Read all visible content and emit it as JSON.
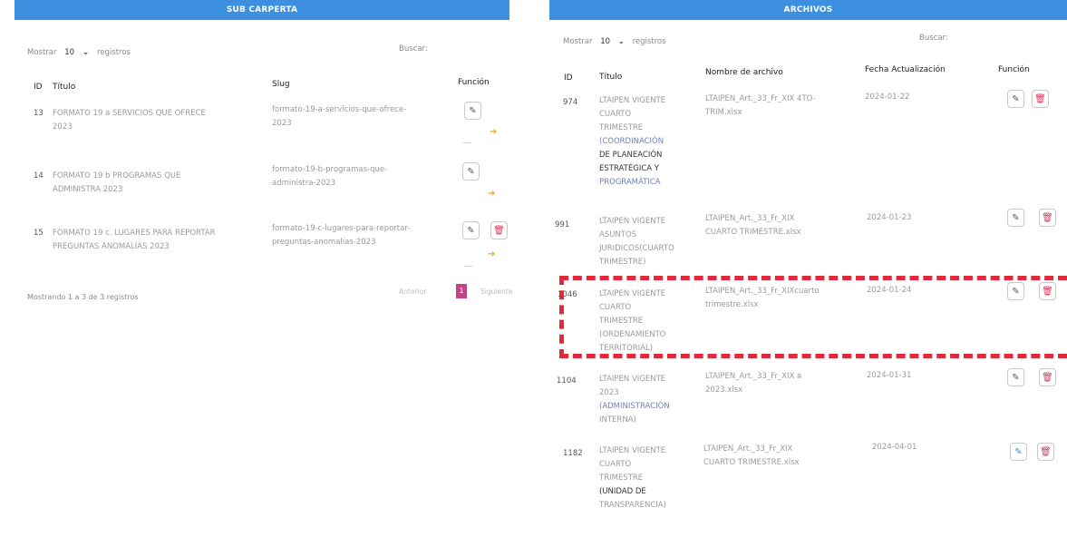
{
  "left": {
    "header": "SUB CARPERTA",
    "show": {
      "prefix": "Mostrar",
      "value": "10",
      "suffix": "registros"
    },
    "search_label": "Buscar:",
    "columns": {
      "id": "ID",
      "title": "Título",
      "slug": "Slug",
      "function": "Función"
    },
    "rows": [
      {
        "id": "13",
        "title_a": "FORMATO 19 a SERVICIOS QUE OFRECE",
        "title_b": "2023",
        "slug_a": "formato-19-a-servicios-que-ofrece-",
        "slug_b": "2023"
      },
      {
        "id": "14",
        "title_a": "FORMATO 19 b PROGRAMAS QUE",
        "title_b": "ADMINISTRA 2023",
        "slug_a": "formato-19-b-programas-que-",
        "slug_b": "administra-2023"
      },
      {
        "id": "15",
        "title_a": "FORMATO 19 c. LUGARES PARA REPORTAR",
        "title_b": "PREGUNTAS ANOMALÍAS 2023",
        "slug_a": "formato-19-c-lugares-para-reportar-",
        "slug_b": "preguntas-anomalias-2023"
      }
    ],
    "footer": "Mostrando 1 a 3 de 3 registros",
    "pager": {
      "prev": "Anterior",
      "page": "1",
      "next": "Siguiente"
    }
  },
  "right": {
    "header": "ARCHIVOS",
    "show": {
      "prefix": "Mostrar",
      "value": "10",
      "suffix": "registros"
    },
    "search_label": "Buscar:",
    "columns": {
      "id": "ID",
      "title": "Título",
      "filename": "Nombre de archivo",
      "date": "Fecha Actualización",
      "function": "Función"
    },
    "rows": [
      {
        "id": "974",
        "title": [
          "LTAIPEN VIGENTE",
          "CUARTO",
          "TRIMESTRE",
          "(COORDINACIÓN",
          "DE PLANEACIÓN",
          "ESTRATÉGICA Y",
          "PROGRAMÁTICA"
        ],
        "file": [
          "LTAIPEN_Art._33_Fr_XIX 4TO-",
          "TRIM.xlsx"
        ],
        "date": "2024-01-22"
      },
      {
        "id": "991",
        "title": [
          "LTAIPEN VIGENTE",
          "ASUNTOS",
          "JURIDICOS(CUARTO",
          "TRIMESTRE)"
        ],
        "file": [
          "LTAIPEN_Art._33_Fr_XIX",
          "CUARTO TRIMESTRE.xlsx"
        ],
        "date": "2024-01-23"
      },
      {
        "id": "1046",
        "title": [
          "LTAIPEN VIGENTE",
          "CUARTO",
          "TRIMESTRE",
          "(ORDENAMIENTO",
          "TERRITORIAL)"
        ],
        "file": [
          "LTAIPEN_Art._33_Fr_XIXcuarto",
          "trimestre.xlsx"
        ],
        "date": "2024-01-24"
      },
      {
        "id": "1104",
        "title": [
          "LTAIPEN VIGENTE",
          "2023",
          "(ADMINISTRACIÓN",
          "INTERNA)"
        ],
        "file": [
          "LTAIPEN_Art._33_Fr_XIX a",
          "2023.xlsx"
        ],
        "date": "2024-01-31"
      },
      {
        "id": "1182",
        "title": [
          "LTAIPEN VIGENTE",
          "CUARTO",
          "TRIMESTRE",
          "(UNIDAD DE",
          "TRANSPARENCIA)"
        ],
        "file": [
          "LTAIPEN_Art._33_Fr_XIX",
          "CUARTO TRIMESTRE.xlsx"
        ],
        "date": "2024-04-01"
      }
    ]
  },
  "colors": {
    "header": "#3d8fe0",
    "delete": "#d63a5a",
    "arrow": "#f0a623",
    "highlight": "#e02a3b",
    "pager_active": "#c2458a"
  }
}
